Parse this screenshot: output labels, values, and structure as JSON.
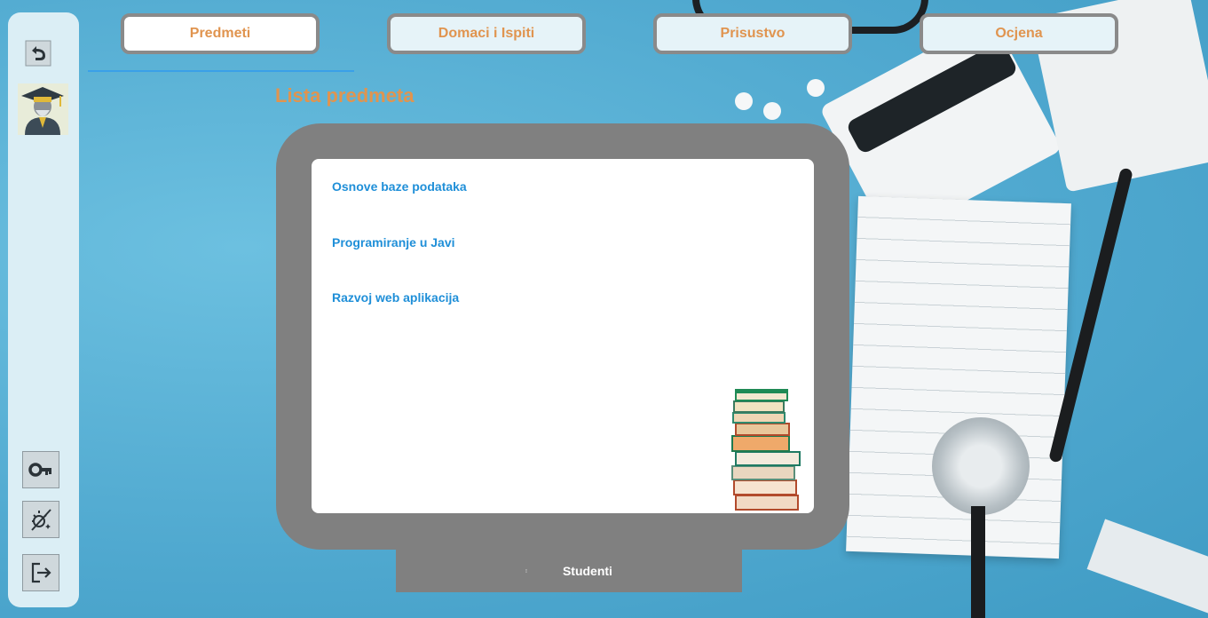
{
  "tabs": [
    {
      "label": "Predmeti",
      "active": true
    },
    {
      "label": "Domaci i Ispiti",
      "active": false
    },
    {
      "label": "Prisustvo",
      "active": false
    },
    {
      "label": "Ocjena",
      "active": false
    }
  ],
  "section_title": "Lista predmeta",
  "subjects": [
    "Osnove baze podataka",
    "Programiranje u Javi",
    "Razvoj web aplikacija"
  ],
  "bottom_tab": {
    "label": "Studenti",
    "marker": "⁝"
  },
  "sidebar": {
    "icons": [
      "undo-icon",
      "student-avatar-icon",
      "key-icon",
      "theme-toggle-icon",
      "logout-icon"
    ]
  },
  "colors": {
    "accent": "#e0944f",
    "link": "#1f8fd8",
    "panel": "#808080",
    "underline": "#3aa0e8"
  }
}
